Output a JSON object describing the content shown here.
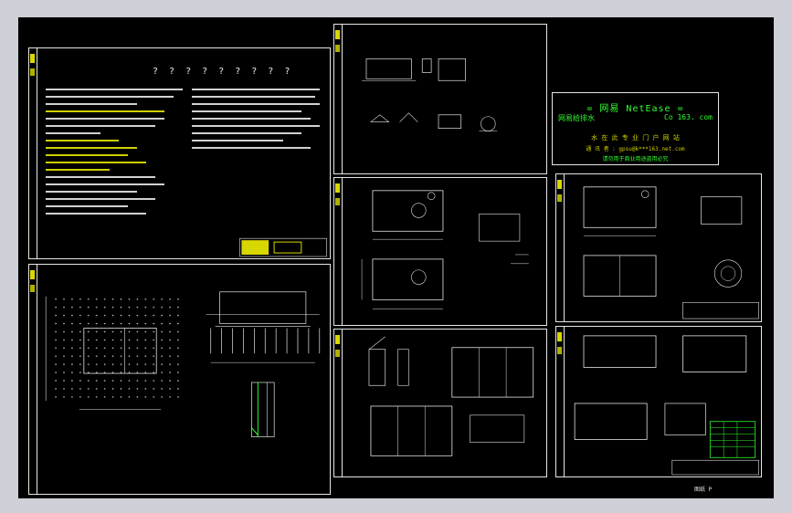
{
  "sheets": {
    "design_notes": {
      "title": "? ? ? ? ? ? ? ? ?"
    },
    "netease": {
      "title": "= 网易 NetEase =",
      "left": "网易给排水",
      "right": "Co 163. com",
      "subtitle": "水 在 此 专 业 门 户 网 站",
      "email": "通 讯 者 : gpsu@k***163.net.com",
      "note": "请勿用于商业用途盗用必究"
    },
    "footer_label": "图纸 P"
  },
  "colors": {
    "canvas": "#000000",
    "line": "#e6e6e6",
    "accent_green": "#30ff30",
    "accent_yellow": "#e6e600"
  }
}
